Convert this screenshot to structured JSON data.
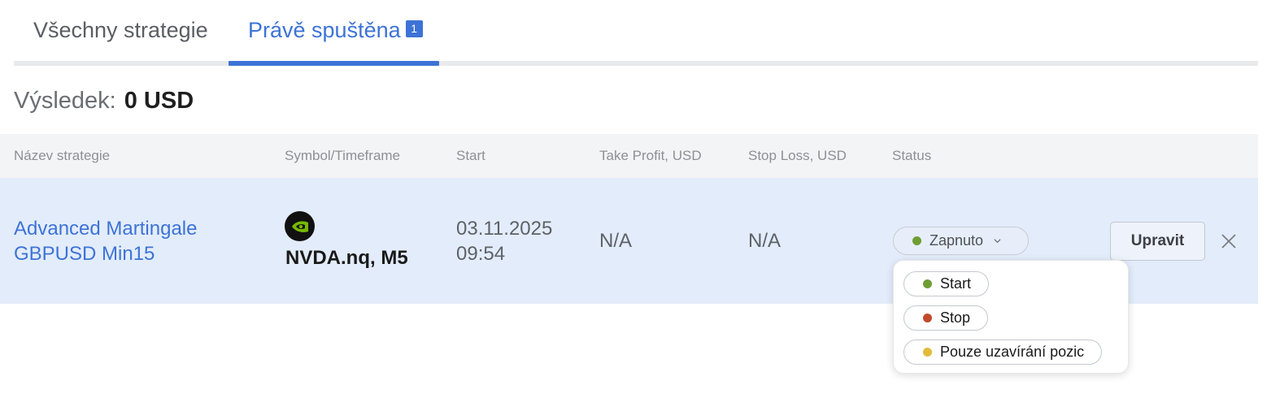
{
  "tabs": [
    {
      "label": "Všechny strategie",
      "active": false
    },
    {
      "label": "Právě spuštěna",
      "active": true,
      "badge": "1"
    }
  ],
  "result": {
    "label": "Výsledek:",
    "value": "0 USD"
  },
  "table": {
    "columns": [
      "Název strategie",
      "Symbol/Timeframe",
      "Start",
      "Take Profit, USD",
      "Stop Loss, USD",
      "Status"
    ],
    "rows": [
      {
        "name_line1": "Advanced Martingale",
        "name_line2": "GBPUSD Min15",
        "symbol_icon": "nvidia-logo-icon",
        "symbol": "NVDA.nq, M5",
        "start_date": "03.11.2025",
        "start_time": "09:54",
        "take_profit": "N/A",
        "stop_loss": "N/A",
        "status": "Zapnuto",
        "status_color": "#6e9e35",
        "edit_label": "Upravit"
      }
    ]
  },
  "status_menu": {
    "options": [
      {
        "label": "Start",
        "color": "#6e9e35"
      },
      {
        "label": "Stop",
        "color": "#c04a2a"
      },
      {
        "label": "Pouze uzavírání pozic",
        "color": "#e2bb3b"
      }
    ]
  },
  "colors": {
    "accent": "#3d73d6",
    "row_highlight": "#e3ecfa",
    "header_bg": "#f3f4f5"
  }
}
